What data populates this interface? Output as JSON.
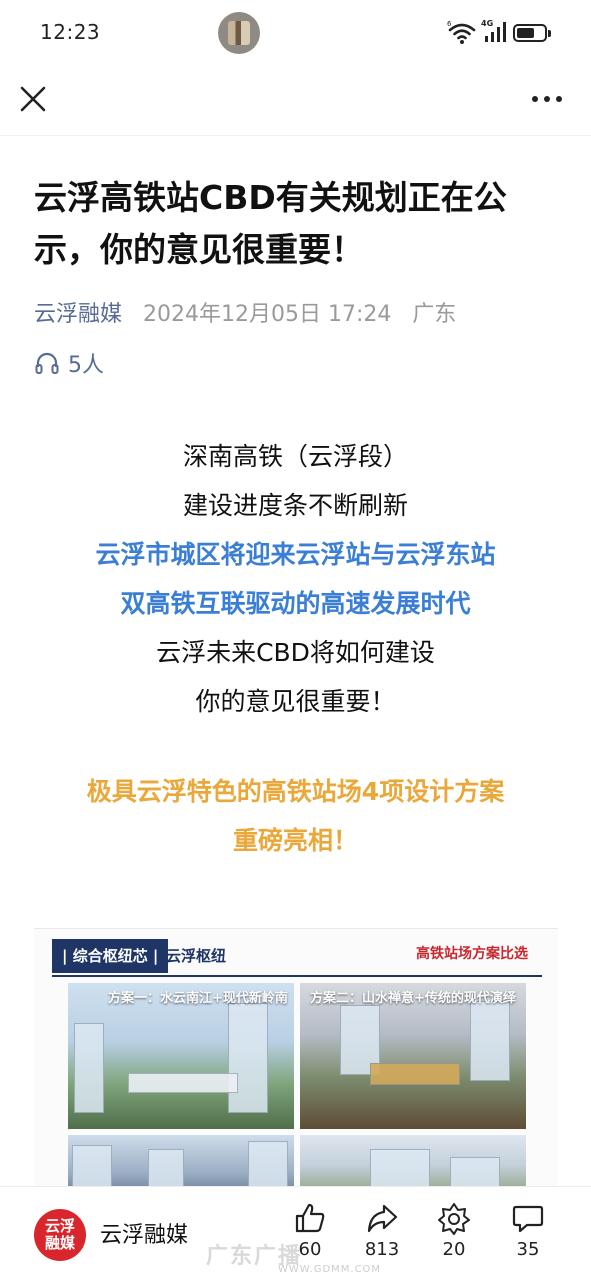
{
  "status_bar": {
    "time": "12:23",
    "network": "4G",
    "wifi_icon": "wifi-icon",
    "signal_icon": "signal-icon",
    "battery_icon": "battery-icon"
  },
  "nav": {
    "close_icon": "close-icon",
    "more_icon": "more-icon"
  },
  "article": {
    "title": "云浮高铁站CBD有关规划正在公示，你的意见很重要！",
    "source": "云浮融媒",
    "datetime": "2024年12月05日 17:24",
    "location": "广东",
    "listeners": "5人",
    "body_lines": [
      {
        "text": "深南高铁（云浮段）",
        "style": "black"
      },
      {
        "text": "建设进度条不断刷新",
        "style": "black"
      },
      {
        "text": "云浮市城区将迎来云浮站与云浮东站",
        "style": "blue"
      },
      {
        "text": "双高铁互联驱动的高速发展时代",
        "style": "blue"
      },
      {
        "text": "云浮未来CBD将如何建设",
        "style": "black"
      },
      {
        "text": "你的意见很重要！",
        "style": "black"
      },
      {
        "text": "极具云浮特色的高铁站场4项设计方案",
        "style": "orange"
      },
      {
        "text": "重磅亮相！",
        "style": "orange"
      }
    ]
  },
  "embed_image": {
    "tag": "| 综合枢纽芯 |",
    "subtitle": "云浮枢纽",
    "right_title": "高铁站场方案比选",
    "plan1_label": "方案一：水云南江+现代新岭南",
    "plan2_label": "方案二：山水禅意+传统的现代演绎"
  },
  "bottom_bar": {
    "account_logo_text": "云浮\n融媒",
    "account_name": "云浮融媒",
    "likes": "60",
    "shares": "813",
    "wows": "20",
    "comments": "35"
  },
  "watermark": {
    "text": "广东广播",
    "url": "WWW.GDMM.COM"
  },
  "colors": {
    "blue_text": "#3a7fd5",
    "orange_text": "#eaa83a",
    "meta_link": "#576b95",
    "account_red": "#d8262c"
  }
}
